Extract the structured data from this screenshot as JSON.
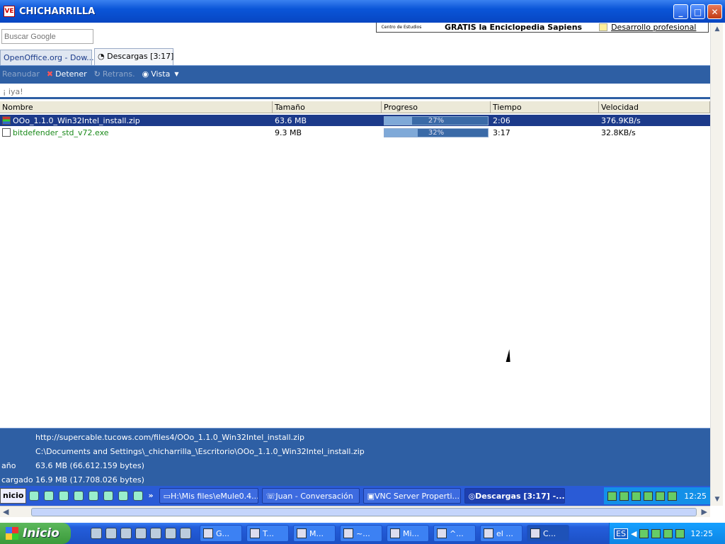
{
  "window": {
    "title": "CHICHARRILLA",
    "icon": "VE"
  },
  "search": {
    "placeholder": "Buscar Google"
  },
  "ad": {
    "logo_text": "Centro de Estudios",
    "text1": "GRATIS la Enciclopedia Sapiens",
    "text2": "Desarrollo profesional"
  },
  "tabs": [
    {
      "label": "OpenOffice.org - Dow..."
    },
    {
      "label": "Descargas [3:17]"
    }
  ],
  "toolbar": {
    "resume": "Reanudar",
    "stop": "Detener",
    "retry": "Retrans.",
    "view": "Vista"
  },
  "filter": {
    "text": "¡ iya!"
  },
  "table": {
    "columns": [
      "Nombre",
      "Tamaño",
      "Progreso",
      "Tiempo",
      "Velocidad"
    ],
    "rows": [
      {
        "name": "OOo_1.1.0_Win32Intel_install.zip",
        "size": "63.6 MB",
        "progress": 27,
        "progress_label": "27%",
        "time": "2:06",
        "speed": "376.9KB/s"
      },
      {
        "name": "bitdefender_std_v72.exe",
        "size": "9.3 MB",
        "progress": 32,
        "progress_label": "32%",
        "time": "3:17",
        "speed": "32.8KB/s"
      }
    ]
  },
  "details": {
    "url": "http://supercable.tucows.com/files4/OOo_1.1.0_Win32Intel_install.zip",
    "path": "C:\\Documents and Settings\\_chicharrilla_\\Escritorio\\OOo_1.1.0_Win32Intel_install.zip",
    "size_label": "año",
    "size_value": "63.6 MB (66.612.159 bytes)",
    "downloaded_label": "cargado",
    "downloaded_value": "16.9 MB (17.708.026 bytes)"
  },
  "inner_taskbar": {
    "start": "nicio",
    "tasks": [
      "H:\\Mis files\\eMule0.4...",
      "Juan - Conversación",
      "VNC Server Properti...",
      "Descargas [3:17] -..."
    ],
    "clock": "12:25"
  },
  "taskbar": {
    "start": "Inicio",
    "tasks": [
      "G...",
      "T...",
      "M...",
      "~...",
      "Mi...",
      "^...",
      "el ...",
      "C..."
    ],
    "lang": "ES",
    "clock": "12:25"
  }
}
